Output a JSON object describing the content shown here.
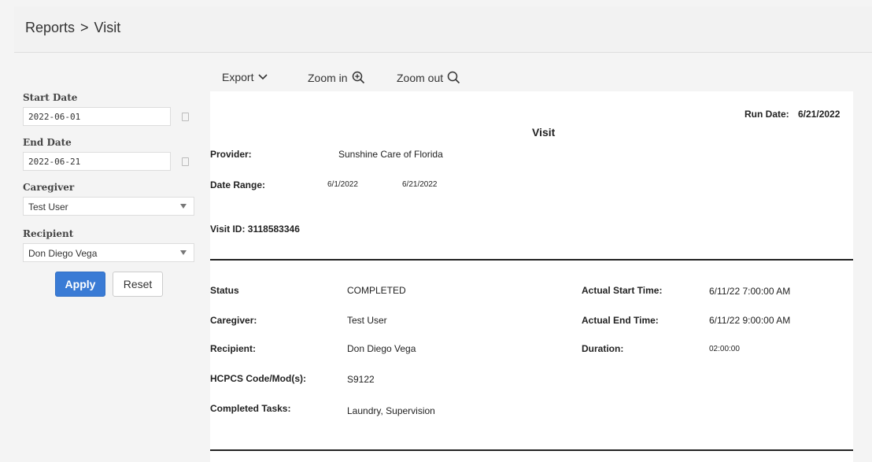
{
  "header": {
    "breadcrumb_root": "Reports",
    "breadcrumb_separator": ">",
    "breadcrumb_current": "Visit"
  },
  "filters": {
    "start_date_label": "Start Date",
    "start_date_value": "2022-06-01",
    "end_date_label": "End Date",
    "end_date_value": "2022-06-21",
    "caregiver_label": "Caregiver",
    "caregiver_value": "Test User",
    "recipient_label": "Recipient",
    "recipient_value": "Don Diego Vega",
    "apply_label": "Apply",
    "reset_label": "Reset"
  },
  "toolbar": {
    "export_label": "Export",
    "zoom_in_label": "Zoom in",
    "zoom_out_label": "Zoom out"
  },
  "report": {
    "title": "Visit",
    "run_date_label": "Run Date:",
    "run_date_value": "6/21/2022",
    "provider_label": "Provider:",
    "provider_value": "Sunshine Care of Florida",
    "date_range_label": "Date Range:",
    "date_range_start": "6/1/2022",
    "date_range_end": "6/21/2022",
    "visit_id_label": "Visit ID: 3118583346",
    "details": {
      "status_label": "Status",
      "status_value": "COMPLETED",
      "caregiver_label": "Caregiver:",
      "caregiver_value": "Test User",
      "recipient_label": "Recipient:",
      "recipient_value": "Don Diego Vega",
      "hcpcs_label": "HCPCS Code/Mod(s):",
      "hcpcs_value": "S9122",
      "tasks_label": "Completed Tasks:",
      "tasks_value": "Laundry, Supervision",
      "actual_start_label": "Actual Start Time:",
      "actual_start_value": "6/11/22 7:00:00 AM",
      "actual_end_label": "Actual End Time:",
      "actual_end_value": "6/11/22 9:00:00 AM",
      "duration_label": "Duration:",
      "duration_value": "02:00:00"
    }
  },
  "colors": {
    "primary": "#3a7bd5",
    "background": "#f4f4f4",
    "panel": "#ffffff"
  }
}
